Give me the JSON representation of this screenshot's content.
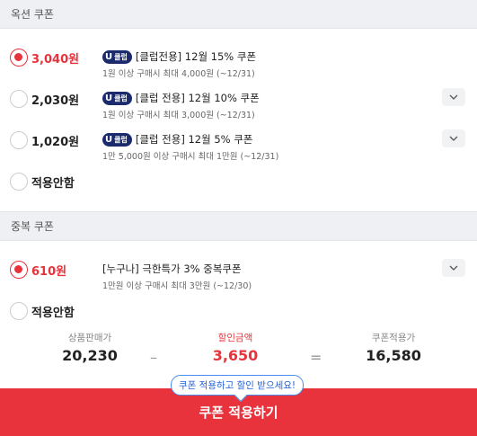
{
  "option_coupons": {
    "header": "옥션 쿠폰",
    "items": [
      {
        "amount": "3,040원",
        "badge_u": "U",
        "badge_text": "클럽",
        "title": "[클럽전용] 12월 15% 쿠폰",
        "sub": "1원 이상 구매시 최대 4,000원 (~12/31)"
      },
      {
        "amount": "2,030원",
        "badge_u": "U",
        "badge_text": "클럽",
        "title": "[클럽 전용] 12월 10% 쿠폰",
        "sub": "1원 이상 구매시 최대 3,000원 (~12/31)"
      },
      {
        "amount": "1,020원",
        "badge_u": "U",
        "badge_text": "클럽",
        "title": "[클럽 전용] 12월 5% 쿠폰",
        "sub": "1만 5,000원 이상 구매시 최대 1만원 (~12/31)"
      }
    ],
    "none_label": "적용안함"
  },
  "dup_coupons": {
    "header": "중복 쿠폰",
    "items": [
      {
        "amount": "610원",
        "title": "[누구나] 극한특가 3% 중복쿠폰",
        "sub": "1만원 이상 구매시 최대 3만원 (~12/30)"
      }
    ],
    "none_label": "적용안함"
  },
  "summary": {
    "price_label": "상품판매가",
    "price_value": "20,230",
    "minus": "–",
    "discount_label": "할인금액",
    "discount_value": "3,650",
    "equals": "=",
    "final_label": "쿠폰적용가",
    "final_value": "16,580"
  },
  "tooltip": "쿠폰 적용하고 할인 받으세요!",
  "cta_label": "쿠폰 적용하기",
  "colors": {
    "accent": "#e8323c",
    "badge": "#1a2a6c",
    "tooltip": "#2563d8"
  }
}
